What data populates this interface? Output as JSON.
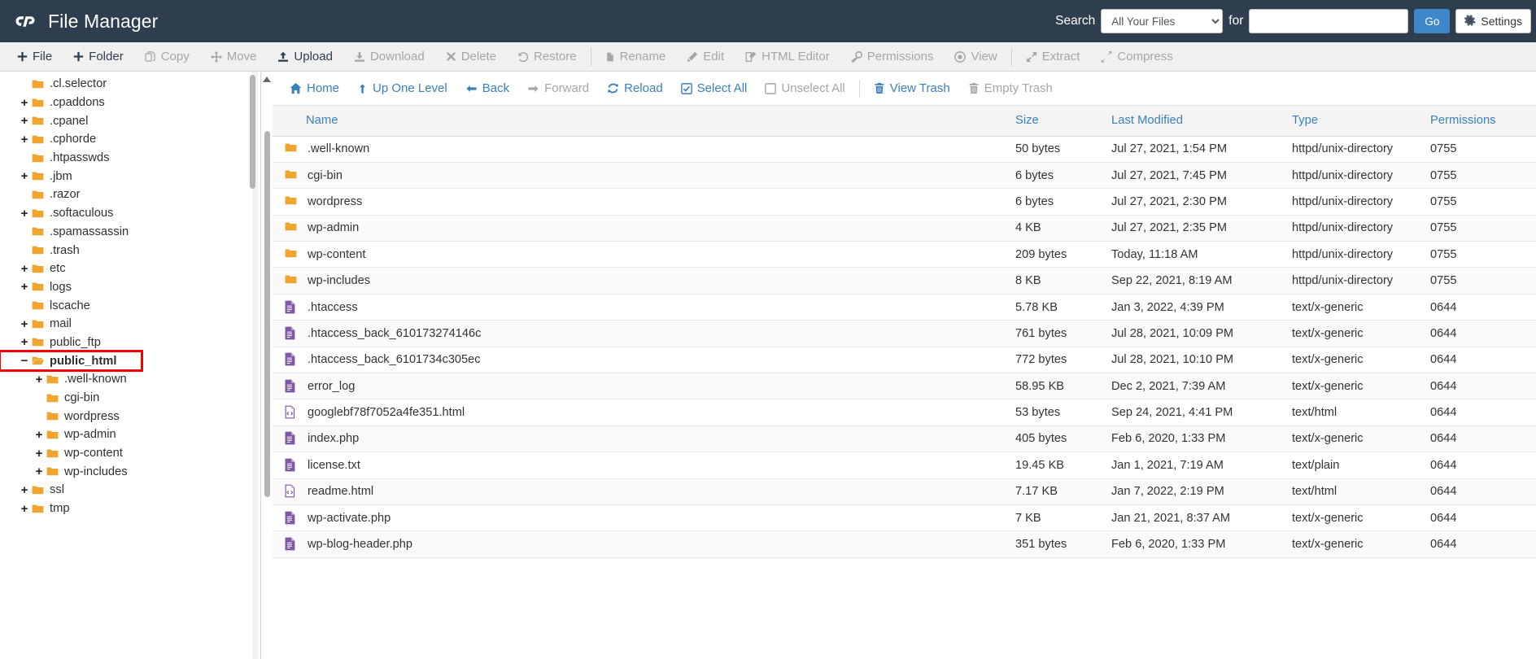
{
  "header": {
    "app_title": "File Manager",
    "logo_icon": "cpanel-logo-icon",
    "search_label": "Search",
    "search_scope_selected": "All Your Files",
    "search_scope_options": [
      "All Your Files"
    ],
    "search_for_label": "for",
    "search_value": "",
    "search_placeholder": "",
    "go_label": "Go",
    "settings_label": "Settings",
    "settings_icon": "gear-icon",
    "accent_blue": "#3e87cb",
    "header_bg": "#2e3e4e"
  },
  "toolbar": {
    "items": [
      {
        "label": "File",
        "icon": "plus-icon",
        "enabled": true
      },
      {
        "label": "Folder",
        "icon": "plus-icon",
        "enabled": true
      },
      {
        "label": "Copy",
        "icon": "copy-icon",
        "enabled": false
      },
      {
        "label": "Move",
        "icon": "move-arrows-icon",
        "enabled": false
      },
      {
        "label": "Upload",
        "icon": "upload-icon",
        "enabled": true
      },
      {
        "label": "Download",
        "icon": "download-icon",
        "enabled": false
      },
      {
        "label": "Delete",
        "icon": "x-mark-icon",
        "enabled": false
      },
      {
        "label": "Restore",
        "icon": "undo-icon",
        "enabled": false
      },
      {
        "label": "Rename",
        "icon": "file-icon",
        "enabled": false
      },
      {
        "label": "Edit",
        "icon": "pencil-icon",
        "enabled": false
      },
      {
        "label": "HTML Editor",
        "icon": "html-editor-icon",
        "enabled": false
      },
      {
        "label": "Permissions",
        "icon": "key-icon",
        "enabled": false
      },
      {
        "label": "View",
        "icon": "eye-icon",
        "enabled": false
      },
      {
        "label": "Extract",
        "icon": "expand-icon",
        "enabled": false
      },
      {
        "label": "Compress",
        "icon": "compress-icon",
        "enabled": false
      }
    ],
    "separators_after": [
      7,
      12
    ]
  },
  "sidebar": {
    "tree": [
      {
        "label": ".cl.selector",
        "toggle": "",
        "depth": 1,
        "selected": false,
        "open": false
      },
      {
        "label": ".cpaddons",
        "toggle": "+",
        "depth": 1,
        "selected": false,
        "open": false
      },
      {
        "label": ".cpanel",
        "toggle": "+",
        "depth": 1,
        "selected": false,
        "open": false
      },
      {
        "label": ".cphorde",
        "toggle": "+",
        "depth": 1,
        "selected": false,
        "open": false
      },
      {
        "label": ".htpasswds",
        "toggle": "",
        "depth": 1,
        "selected": false,
        "open": false
      },
      {
        "label": ".jbm",
        "toggle": "+",
        "depth": 1,
        "selected": false,
        "open": false
      },
      {
        "label": ".razor",
        "toggle": "",
        "depth": 1,
        "selected": false,
        "open": false
      },
      {
        "label": ".softaculous",
        "toggle": "+",
        "depth": 1,
        "selected": false,
        "open": false
      },
      {
        "label": ".spamassassin",
        "toggle": "",
        "depth": 1,
        "selected": false,
        "open": false
      },
      {
        "label": ".trash",
        "toggle": "",
        "depth": 1,
        "selected": false,
        "open": false
      },
      {
        "label": "etc",
        "toggle": "+",
        "depth": 1,
        "selected": false,
        "open": false
      },
      {
        "label": "logs",
        "toggle": "+",
        "depth": 1,
        "selected": false,
        "open": false
      },
      {
        "label": "lscache",
        "toggle": "",
        "depth": 1,
        "selected": false,
        "open": false
      },
      {
        "label": "mail",
        "toggle": "+",
        "depth": 1,
        "selected": false,
        "open": false
      },
      {
        "label": "public_ftp",
        "toggle": "+",
        "depth": 1,
        "selected": false,
        "open": false
      },
      {
        "label": "public_html",
        "toggle": "−",
        "depth": 1,
        "selected": true,
        "open": true
      },
      {
        "label": ".well-known",
        "toggle": "+",
        "depth": 2,
        "selected": false,
        "open": false
      },
      {
        "label": "cgi-bin",
        "toggle": "",
        "depth": 2,
        "selected": false,
        "open": false
      },
      {
        "label": "wordpress",
        "toggle": "",
        "depth": 2,
        "selected": false,
        "open": false
      },
      {
        "label": "wp-admin",
        "toggle": "+",
        "depth": 2,
        "selected": false,
        "open": false
      },
      {
        "label": "wp-content",
        "toggle": "+",
        "depth": 2,
        "selected": false,
        "open": false
      },
      {
        "label": "wp-includes",
        "toggle": "+",
        "depth": 2,
        "selected": false,
        "open": false
      },
      {
        "label": "ssl",
        "toggle": "+",
        "depth": 1,
        "selected": false,
        "open": false
      },
      {
        "label": "tmp",
        "toggle": "+",
        "depth": 1,
        "selected": false,
        "open": false
      }
    ],
    "folder_color": "#f0a62e",
    "highlight_color": "#f40000"
  },
  "navbar": {
    "items": [
      {
        "label": "Home",
        "icon": "home-icon",
        "enabled": true
      },
      {
        "label": "Up One Level",
        "icon": "arrow-up-icon",
        "enabled": true
      },
      {
        "label": "Back",
        "icon": "arrow-left-icon",
        "enabled": true
      },
      {
        "label": "Forward",
        "icon": "arrow-right-icon",
        "enabled": false
      },
      {
        "label": "Reload",
        "icon": "reload-icon",
        "enabled": true
      },
      {
        "label": "Select All",
        "icon": "checked-box-icon",
        "enabled": true
      },
      {
        "label": "Unselect All",
        "icon": "empty-box-icon",
        "enabled": false
      },
      {
        "label": "View Trash",
        "icon": "trash-icon",
        "enabled": true
      },
      {
        "label": "Empty Trash",
        "icon": "trash-icon",
        "enabled": false
      }
    ],
    "separator_after": 6
  },
  "file_table": {
    "columns": [
      "Name",
      "Size",
      "Last Modified",
      "Type",
      "Permissions"
    ],
    "rows": [
      {
        "icon": "folder-icon",
        "name": ".well-known",
        "size": "50 bytes",
        "modified": "Jul 27, 2021, 1:54 PM",
        "type": "httpd/unix-directory",
        "permissions": "0755"
      },
      {
        "icon": "folder-icon",
        "name": "cgi-bin",
        "size": "6 bytes",
        "modified": "Jul 27, 2021, 7:45 PM",
        "type": "httpd/unix-directory",
        "permissions": "0755"
      },
      {
        "icon": "folder-icon",
        "name": "wordpress",
        "size": "6 bytes",
        "modified": "Jul 27, 2021, 2:30 PM",
        "type": "httpd/unix-directory",
        "permissions": "0755"
      },
      {
        "icon": "folder-icon",
        "name": "wp-admin",
        "size": "4 KB",
        "modified": "Jul 27, 2021, 2:35 PM",
        "type": "httpd/unix-directory",
        "permissions": "0755"
      },
      {
        "icon": "folder-icon",
        "name": "wp-content",
        "size": "209 bytes",
        "modified": "Today, 11:18 AM",
        "type": "httpd/unix-directory",
        "permissions": "0755"
      },
      {
        "icon": "folder-icon",
        "name": "wp-includes",
        "size": "8 KB",
        "modified": "Sep 22, 2021, 8:19 AM",
        "type": "httpd/unix-directory",
        "permissions": "0755"
      },
      {
        "icon": "text-file-icon",
        "name": ".htaccess",
        "size": "5.78 KB",
        "modified": "Jan 3, 2022, 4:39 PM",
        "type": "text/x-generic",
        "permissions": "0644"
      },
      {
        "icon": "text-file-icon",
        "name": ".htaccess_back_610173274146c",
        "size": "761 bytes",
        "modified": "Jul 28, 2021, 10:09 PM",
        "type": "text/x-generic",
        "permissions": "0644"
      },
      {
        "icon": "text-file-icon",
        "name": ".htaccess_back_6101734c305ec",
        "size": "772 bytes",
        "modified": "Jul 28, 2021, 10:10 PM",
        "type": "text/x-generic",
        "permissions": "0644"
      },
      {
        "icon": "text-file-icon",
        "name": "error_log",
        "size": "58.95 KB",
        "modified": "Dec 2, 2021, 7:39 AM",
        "type": "text/x-generic",
        "permissions": "0644"
      },
      {
        "icon": "html-file-icon",
        "name": "googlebf78f7052a4fe351.html",
        "size": "53 bytes",
        "modified": "Sep 24, 2021, 4:41 PM",
        "type": "text/html",
        "permissions": "0644"
      },
      {
        "icon": "text-file-icon",
        "name": "index.php",
        "size": "405 bytes",
        "modified": "Feb 6, 2020, 1:33 PM",
        "type": "text/x-generic",
        "permissions": "0644"
      },
      {
        "icon": "text-file-icon",
        "name": "license.txt",
        "size": "19.45 KB",
        "modified": "Jan 1, 2021, 7:19 AM",
        "type": "text/plain",
        "permissions": "0644"
      },
      {
        "icon": "html-file-icon",
        "name": "readme.html",
        "size": "7.17 KB",
        "modified": "Jan 7, 2022, 2:19 PM",
        "type": "text/html",
        "permissions": "0644"
      },
      {
        "icon": "text-file-icon",
        "name": "wp-activate.php",
        "size": "7 KB",
        "modified": "Jan 21, 2021, 8:37 AM",
        "type": "text/x-generic",
        "permissions": "0644"
      },
      {
        "icon": "text-file-icon",
        "name": "wp-blog-header.php",
        "size": "351 bytes",
        "modified": "Feb 6, 2020, 1:33 PM",
        "type": "text/x-generic",
        "permissions": "0644"
      }
    ]
  }
}
